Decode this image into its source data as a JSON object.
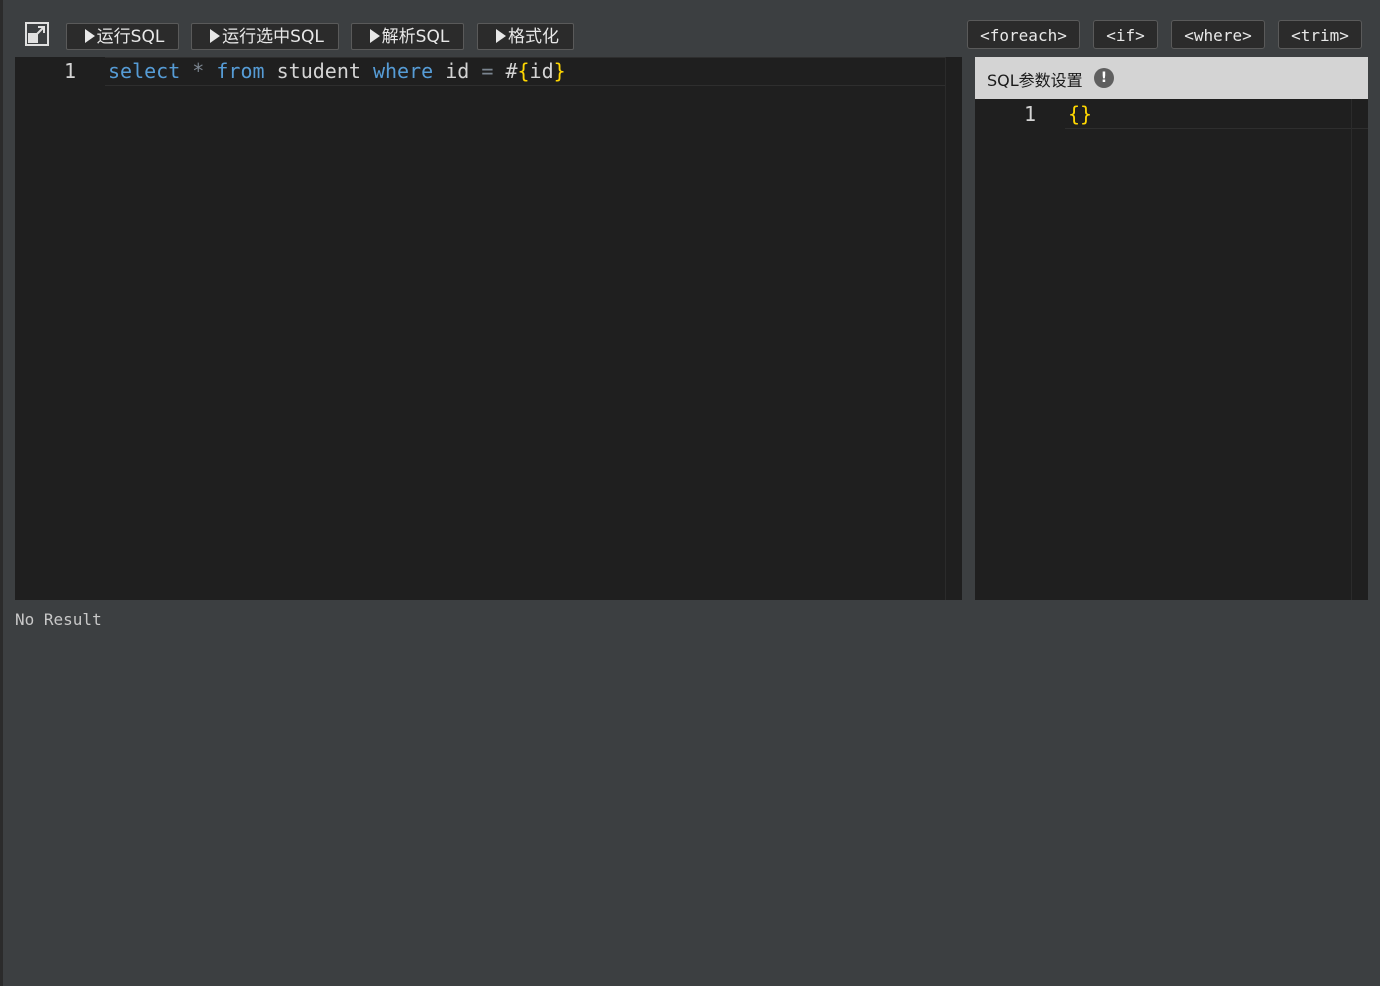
{
  "toolbar": {
    "run_sql": "运行SQL",
    "run_selected_sql": "运行选中SQL",
    "parse_sql": "解析SQL",
    "format": "格式化"
  },
  "tags": {
    "foreach": "<foreach>",
    "if": "<if>",
    "where": "<where>",
    "trim": "<trim>"
  },
  "editor": {
    "line_number": "1",
    "tokens": {
      "select": "select",
      "star": "*",
      "from": "from",
      "table": "student",
      "where": "where",
      "column": "id",
      "eq": "=",
      "hash": "#",
      "lbrace": "{",
      "param": "id",
      "rbrace": "}"
    }
  },
  "params": {
    "title": "SQL参数设置",
    "info": "!",
    "line_number": "1",
    "lbrace": "{",
    "rbrace": "}"
  },
  "result": {
    "text": "No Result"
  }
}
